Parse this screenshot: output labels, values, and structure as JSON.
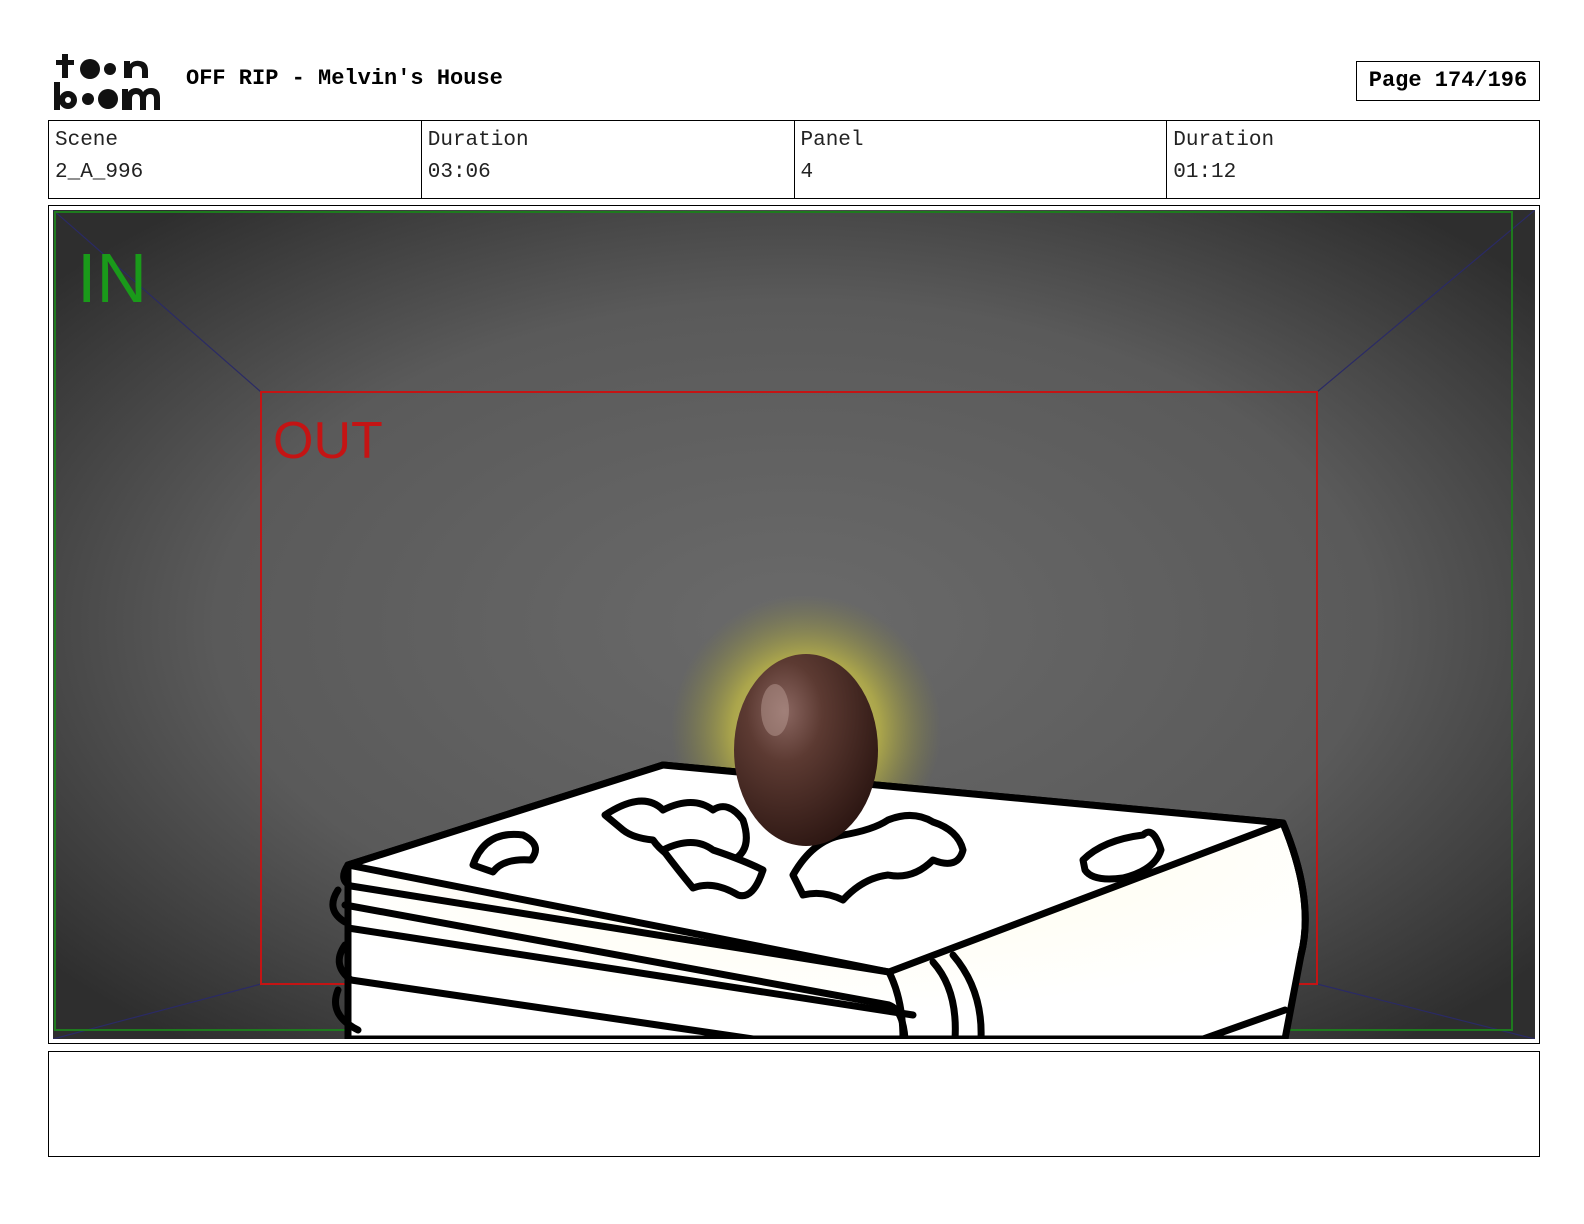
{
  "header": {
    "logo_text_top": "toon",
    "logo_text_bottom": "boom",
    "title": "OFF RIP - Melvin's House",
    "page_label": "Page 174/196"
  },
  "info": [
    {
      "label": "Scene",
      "value": "2_A_996"
    },
    {
      "label": "Duration",
      "value": "03:06"
    },
    {
      "label": "Panel",
      "value": "4"
    },
    {
      "label": "Duration",
      "value": "01:12"
    }
  ],
  "panel": {
    "in_label": "IN",
    "out_label": "OUT",
    "in_color": "#1a9a1a",
    "out_color": "#c41414"
  },
  "notes": {
    "text": ""
  }
}
